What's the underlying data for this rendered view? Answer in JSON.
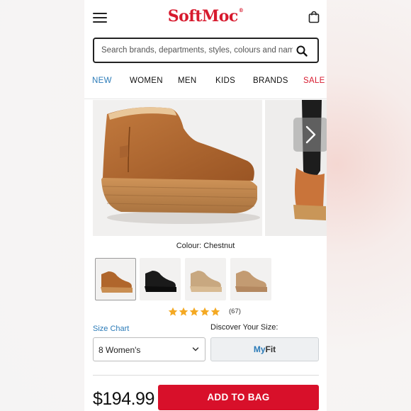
{
  "header": {
    "logo": "SoftMoc",
    "logo_mark": "®",
    "menu_icon": "hamburger-menu-icon",
    "bag_icon": "shopping-bag-icon"
  },
  "search": {
    "placeholder": "Search brands, departments, styles, colours and names",
    "value": "",
    "icon": "search-icon"
  },
  "nav": {
    "items": [
      {
        "label": "NEW",
        "color": "#2b7bb8"
      },
      {
        "label": "WOMEN",
        "color": "#111111"
      },
      {
        "label": "MEN",
        "color": "#111111"
      },
      {
        "label": "KIDS",
        "color": "#111111"
      },
      {
        "label": "BRANDS",
        "color": "#111111"
      },
      {
        "label": "SALE",
        "color": "#d71a2e"
      }
    ]
  },
  "gallery": {
    "next_icon": "chevron-right-icon"
  },
  "product": {
    "colour_text": "Colour: Chestnut",
    "swatches": [
      {
        "name": "chestnut",
        "color": "#b0662c",
        "selected": true
      },
      {
        "name": "black",
        "color": "#1a1a1a",
        "selected": false
      },
      {
        "name": "sand",
        "color": "#c8a880",
        "selected": false
      },
      {
        "name": "tan",
        "color": "#c39b72",
        "selected": false
      }
    ],
    "rating_stars": 5,
    "review_count": "(67)",
    "price": "$194.99"
  },
  "size": {
    "chart_label": "Size Chart",
    "discover_label": "Discover Your Size:",
    "selected": "8 Women's",
    "myfit_my": "My",
    "myfit_fit": "Fit"
  },
  "cart": {
    "add_label": "ADD TO BAG"
  },
  "colors": {
    "brand_red": "#d71a2e",
    "button_red": "#d8102a",
    "link_blue": "#2b7bb8",
    "star_gold": "#f4a923"
  }
}
